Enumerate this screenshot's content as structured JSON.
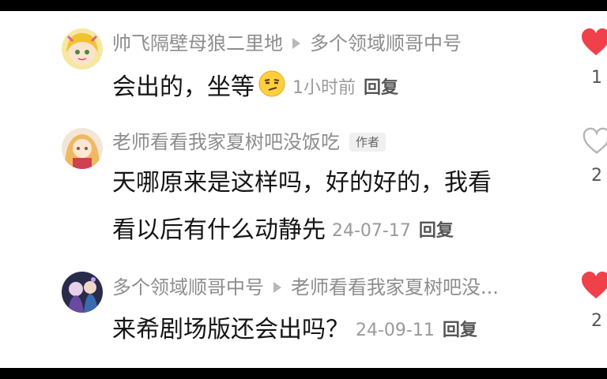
{
  "comments": [
    {
      "author": "帅飞隔壁母狼二里地",
      "reply_to": "多个领域顺哥中号",
      "text": "会出的，坐等",
      "time": "1小时前",
      "reply_label": "回复",
      "likes": "1",
      "liked": true,
      "emoji": "smirk-emoji"
    },
    {
      "author": "老师看看我家夏树吧没饭吃",
      "badge": "作者",
      "text_line1": "天哪原来是这样吗，好的好的，我看",
      "text_line2": "看以后有什么动静先",
      "time": "24-07-17",
      "reply_label": "回复",
      "likes": "2",
      "liked": false
    },
    {
      "author": "多个领域顺哥中号",
      "reply_to": "老师看看我家夏树吧没...",
      "text": "来希剧场版还会出吗？",
      "time": "24-09-11",
      "reply_label": "回复",
      "likes": "2",
      "liked": true
    }
  ],
  "colors": {
    "liked_heart": "#f0404a",
    "unliked_heart": "#b5b5b5",
    "name_gray": "#8d8d8d",
    "text_dark": "#151515"
  }
}
